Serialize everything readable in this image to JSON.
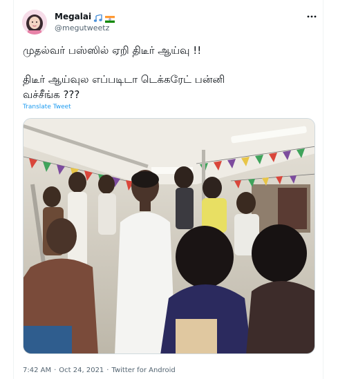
{
  "author": {
    "display_name": "Megalai",
    "handle": "@megutweetz",
    "emojis": [
      "music-notes-emoji",
      "india-flag-emoji"
    ]
  },
  "tweet": {
    "line1": "முதல்வர் பஸ்ஸில் ஏறி திடீர் ஆய்வு !!",
    "line2": "திடீர் ஆய்வுல எப்படிடா டெக்கரேட் பன்னி\nவச்சீங்க ???",
    "translate_label": "Translate Tweet"
  },
  "media": {
    "description_icon": "photo",
    "colors": {
      "ceiling": "#d9d4c9",
      "rail": "#b9b6ae",
      "shirt": "#f4f4f2",
      "skin": "#6b4a36",
      "bunting_red": "#d9463b",
      "bunting_green": "#3fa35b",
      "bunting_purple": "#7d4c9e",
      "bunting_yellow": "#e8c547"
    }
  },
  "meta": {
    "time": "7:42 AM",
    "separator": "·",
    "date": "Oct 24, 2021",
    "source": "Twitter for Android"
  },
  "more_icon": "more-dots-icon"
}
